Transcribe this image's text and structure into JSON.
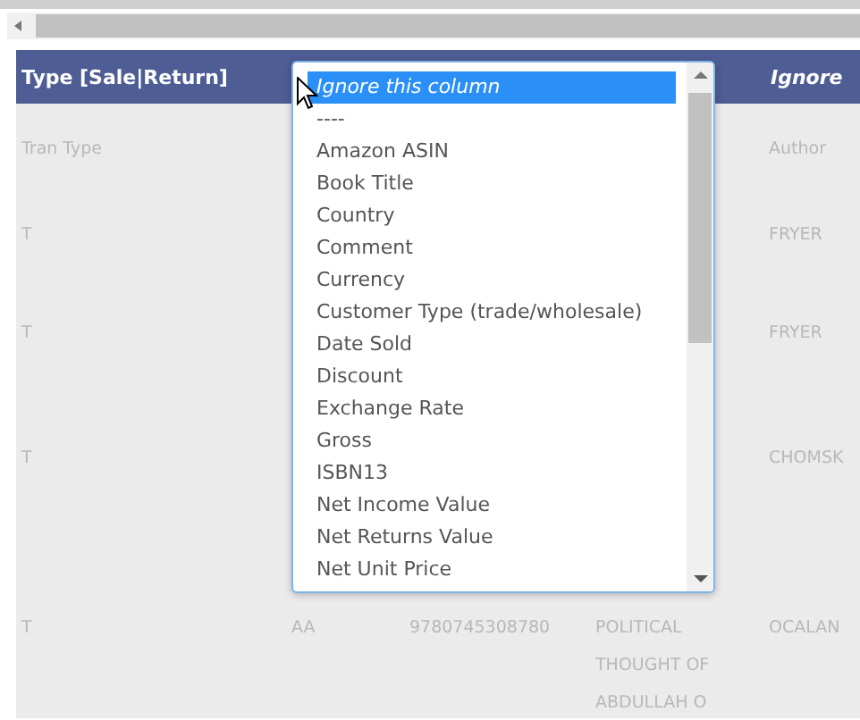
{
  "table": {
    "header": {
      "column_1": "Type [Sale|Return]",
      "column_5": "Ignore"
    },
    "rows": [
      {
        "column_1": "Tran Type",
        "column_5": "Author"
      },
      {
        "column_1": "T",
        "column_5": "FRYER"
      },
      {
        "column_1": "T",
        "column_5": "FRYER"
      },
      {
        "column_1": "T",
        "column_5": "CHOMSK"
      },
      {
        "column_1": "T",
        "column_2": "AA",
        "column_3": "9780745308780",
        "column_4": "POLITICAL THOUGHT OF ABDULLAH O",
        "column_5": "OCALAN"
      }
    ]
  },
  "dropdown": {
    "options": [
      {
        "label": "Ignore this column",
        "selected": true
      },
      {
        "label": "----",
        "selected": false
      },
      {
        "label": "Amazon ASIN",
        "selected": false
      },
      {
        "label": "Book Title",
        "selected": false
      },
      {
        "label": "Country",
        "selected": false
      },
      {
        "label": "Comment",
        "selected": false
      },
      {
        "label": "Currency",
        "selected": false
      },
      {
        "label": "Customer Type (trade/wholesale)",
        "selected": false
      },
      {
        "label": "Date Sold",
        "selected": false
      },
      {
        "label": "Discount",
        "selected": false
      },
      {
        "label": "Exchange Rate",
        "selected": false
      },
      {
        "label": "Gross",
        "selected": false
      },
      {
        "label": "ISBN13",
        "selected": false
      },
      {
        "label": "Net Income Value",
        "selected": false
      },
      {
        "label": "Net Returns Value",
        "selected": false
      },
      {
        "label": "Net Unit Price",
        "selected": false
      }
    ]
  }
}
